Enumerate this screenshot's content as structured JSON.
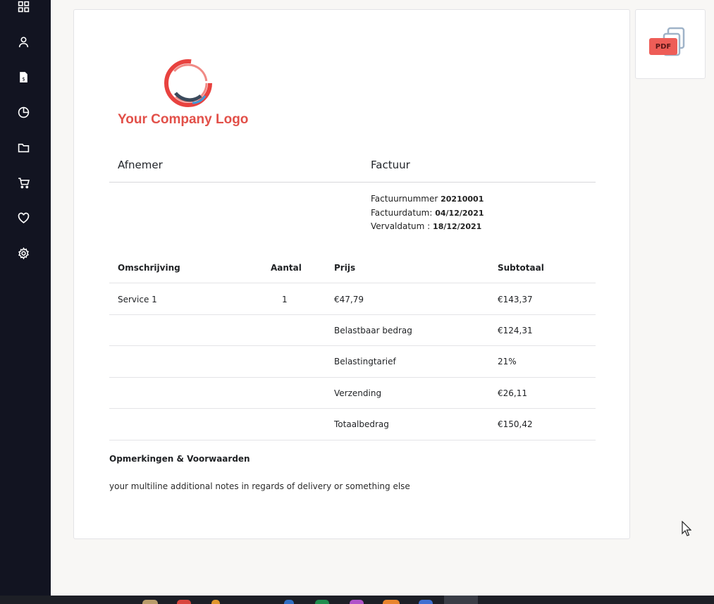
{
  "colors": {
    "sidebar_bg": "#121421",
    "brand_red": "#e25049",
    "pdf_badge": "#ee5d57"
  },
  "sidebar": {
    "icons": [
      "grid-icon",
      "user-icon",
      "invoice-icon",
      "pie-chart-icon",
      "folder-icon",
      "cart-icon",
      "heart-icon",
      "gear-icon"
    ]
  },
  "invoice": {
    "logo_text": "Your Company Logo",
    "customer_heading": "Afnemer",
    "invoice_heading": "Factuur",
    "meta": {
      "number_label": "Factuurnummer",
      "number_value": "20210001",
      "date_label": "Factuurdatum:",
      "date_value": "04/12/2021",
      "due_label": "Vervaldatum :",
      "due_value": "18/12/2021"
    },
    "table": {
      "headers": {
        "description": "Omschrijving",
        "quantity": "Aantal",
        "price": "Prijs",
        "subtotal": "Subtotaal"
      },
      "item": {
        "description": "Service 1",
        "quantity": "1",
        "price": "€47,79",
        "subtotal": "€143,37"
      },
      "summary": [
        {
          "label": "Belastbaar bedrag",
          "value": "€124,31"
        },
        {
          "label": "Belastingtarief",
          "value": "21%"
        },
        {
          "label": "Verzending",
          "value": "€26,11"
        },
        {
          "label": "Totaalbedrag",
          "value": "€150,42"
        }
      ]
    },
    "notes_title": "Opmerkingen & Voorwaarden",
    "notes_text": "your multiline additional notes in regards of delivery or something else"
  },
  "pdf_button": {
    "label": "PDF"
  }
}
